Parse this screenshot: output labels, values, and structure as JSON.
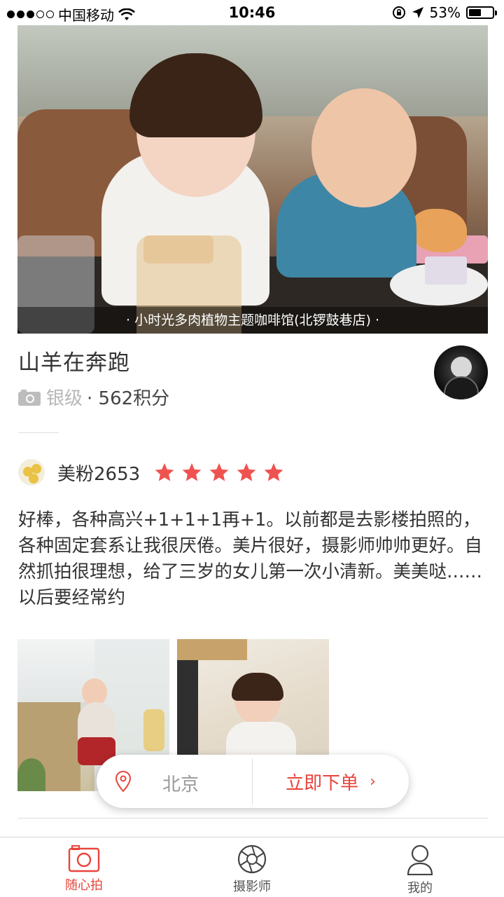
{
  "status_bar": {
    "carrier": "中国移动",
    "time": "10:46",
    "battery_percent": "53%",
    "battery_level": 0.53
  },
  "hero": {
    "caption": "· 小时光多肉植物主题咖啡馆(北锣鼓巷店) ·"
  },
  "profile": {
    "name": "山羊在奔跑",
    "level": "银级",
    "points": "· 562积分"
  },
  "review": {
    "reviewer_name": "美粉2653",
    "rating": 5,
    "max_rating": 5,
    "text": "好棒，各种高兴+1+1+1再+1。以前都是去影楼拍照的，各种固定套系让我很厌倦。美片很好，摄影师帅帅更好。自然抓拍很理想，给了三岁的女儿第一次小清新。美美哒……以后要经常约"
  },
  "action_bar": {
    "city": "北京",
    "order_label": "立即下单",
    "chevron": "›"
  },
  "tabs": [
    {
      "label": "随心拍",
      "icon": "camera-icon",
      "active": true
    },
    {
      "label": "摄影师",
      "icon": "aperture-icon",
      "active": false
    },
    {
      "label": "我的",
      "icon": "person-icon",
      "active": false
    }
  ],
  "colors": {
    "accent": "#e8453c",
    "star": "#ef5350",
    "muted": "#999999"
  }
}
